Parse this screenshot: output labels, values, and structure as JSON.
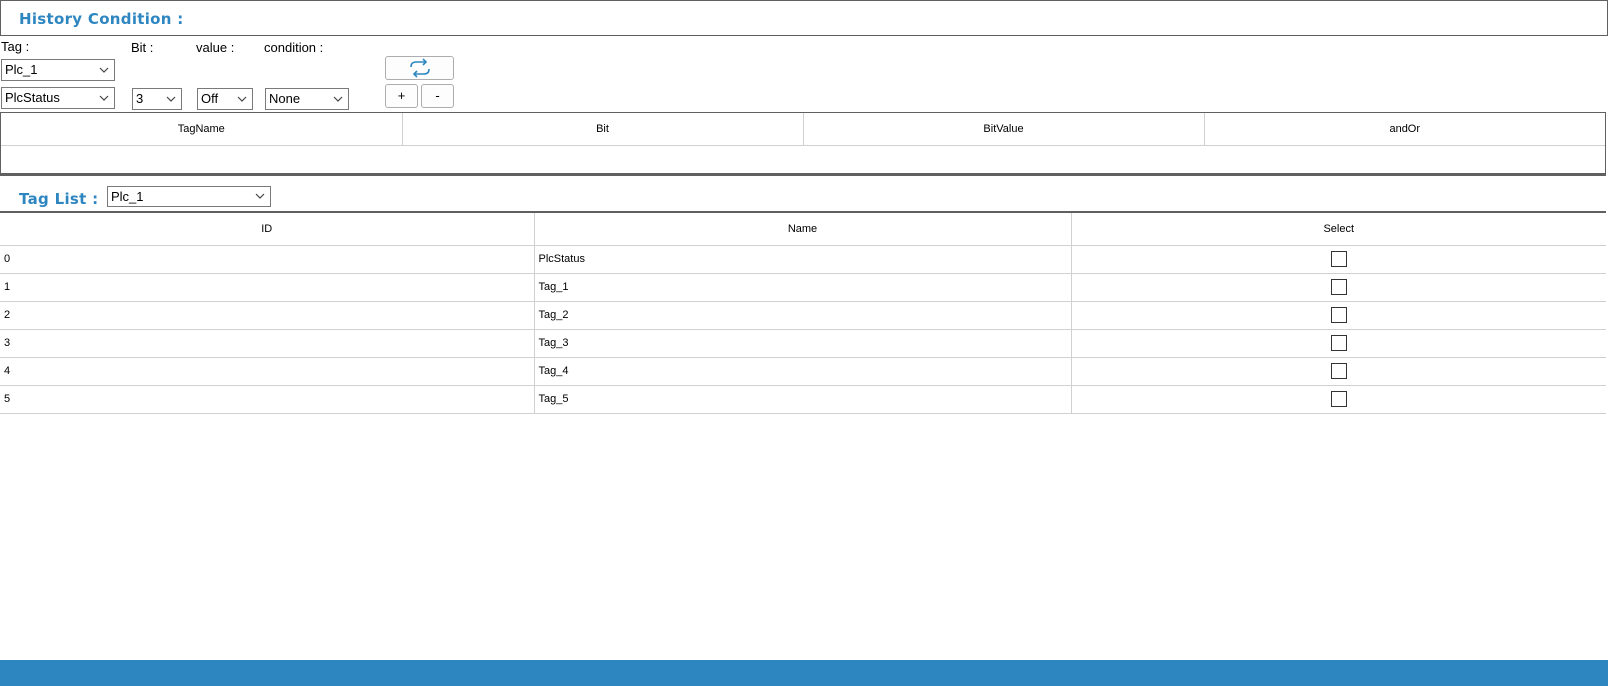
{
  "history": {
    "title": "History Condition :",
    "labels": {
      "tag": "Tag :",
      "bit": "Bit :",
      "value": "value :",
      "condition": "condition :"
    },
    "plc_select": "Plc_1",
    "tag_select": "PlcStatus",
    "bit_select": "3",
    "value_select": "Off",
    "condition_select": "None",
    "add_label": "+",
    "remove_label": "-",
    "refresh_icon": "refresh-icon"
  },
  "condition_grid": {
    "columns": [
      "TagName",
      "Bit",
      "BitValue",
      "andOr"
    ],
    "rows": []
  },
  "tag_list": {
    "title": "Tag List :",
    "plc_select": "Plc_1",
    "columns": [
      "ID",
      "Name",
      "Select"
    ],
    "rows": [
      {
        "id": "0",
        "name": "PlcStatus",
        "selected": false
      },
      {
        "id": "1",
        "name": "Tag_1",
        "selected": false
      },
      {
        "id": "2",
        "name": "Tag_2",
        "selected": false
      },
      {
        "id": "3",
        "name": "Tag_3",
        "selected": false
      },
      {
        "id": "4",
        "name": "Tag_4",
        "selected": false
      },
      {
        "id": "5",
        "name": "Tag_5",
        "selected": false
      }
    ]
  },
  "colors": {
    "accent": "#2e86c1",
    "border": "#606060",
    "grid_line": "#d0d0d0"
  }
}
